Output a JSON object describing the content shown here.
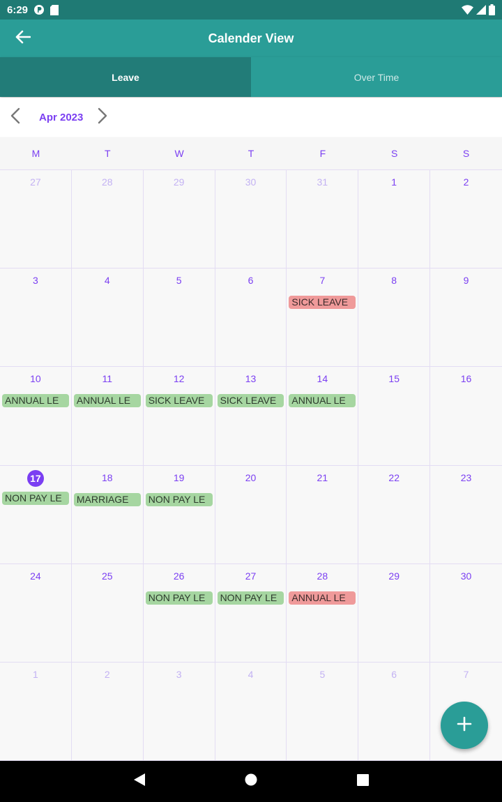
{
  "status": {
    "time": "6:29"
  },
  "app": {
    "title": "Calender View"
  },
  "tabs": [
    {
      "label": "Leave",
      "active": true
    },
    {
      "label": "Over Time",
      "active": false
    }
  ],
  "calendar": {
    "month": "Apr 2023",
    "weekdays": [
      "M",
      "T",
      "W",
      "T",
      "F",
      "S",
      "S"
    ],
    "cells": [
      {
        "day": "27",
        "muted": true,
        "events": []
      },
      {
        "day": "28",
        "muted": true,
        "events": []
      },
      {
        "day": "29",
        "muted": true,
        "events": []
      },
      {
        "day": "30",
        "muted": true,
        "events": []
      },
      {
        "day": "31",
        "muted": true,
        "events": []
      },
      {
        "day": "1",
        "events": []
      },
      {
        "day": "2",
        "events": []
      },
      {
        "day": "3",
        "events": []
      },
      {
        "day": "4",
        "events": []
      },
      {
        "day": "5",
        "events": []
      },
      {
        "day": "6",
        "events": []
      },
      {
        "day": "7",
        "events": [
          {
            "label": "SICK LEAVE",
            "color": "red"
          }
        ]
      },
      {
        "day": "8",
        "events": []
      },
      {
        "day": "9",
        "events": []
      },
      {
        "day": "10",
        "events": [
          {
            "label": "ANNUAL LE",
            "color": "green"
          }
        ]
      },
      {
        "day": "11",
        "events": [
          {
            "label": "ANNUAL LE",
            "color": "green"
          }
        ]
      },
      {
        "day": "12",
        "events": [
          {
            "label": "SICK LEAVE",
            "color": "green"
          }
        ]
      },
      {
        "day": "13",
        "events": [
          {
            "label": "SICK LEAVE",
            "color": "green"
          }
        ]
      },
      {
        "day": "14",
        "events": [
          {
            "label": "ANNUAL LE",
            "color": "green"
          }
        ]
      },
      {
        "day": "15",
        "events": []
      },
      {
        "day": "16",
        "events": []
      },
      {
        "day": "17",
        "today": true,
        "events": [
          {
            "label": "NON PAY LE",
            "color": "green"
          }
        ]
      },
      {
        "day": "18",
        "events": [
          {
            "label": "MARRIAGE",
            "color": "green"
          }
        ]
      },
      {
        "day": "19",
        "events": [
          {
            "label": "NON PAY LE",
            "color": "green"
          }
        ]
      },
      {
        "day": "20",
        "events": []
      },
      {
        "day": "21",
        "events": []
      },
      {
        "day": "22",
        "events": []
      },
      {
        "day": "23",
        "events": []
      },
      {
        "day": "24",
        "events": []
      },
      {
        "day": "25",
        "events": []
      },
      {
        "day": "26",
        "events": [
          {
            "label": "NON PAY LE",
            "color": "green"
          }
        ]
      },
      {
        "day": "27",
        "events": [
          {
            "label": "NON PAY LE",
            "color": "green"
          }
        ]
      },
      {
        "day": "28",
        "events": [
          {
            "label": "ANNUAL LE",
            "color": "red"
          }
        ]
      },
      {
        "day": "29",
        "events": []
      },
      {
        "day": "30",
        "events": []
      },
      {
        "day": "1",
        "muted": true,
        "events": []
      },
      {
        "day": "2",
        "muted": true,
        "events": []
      },
      {
        "day": "3",
        "muted": true,
        "events": []
      },
      {
        "day": "4",
        "muted": true,
        "events": []
      },
      {
        "day": "5",
        "muted": true,
        "events": []
      },
      {
        "day": "6",
        "muted": true,
        "events": []
      },
      {
        "day": "7",
        "muted": true,
        "events": []
      }
    ]
  },
  "fab": {
    "icon": "plus-icon"
  },
  "colors": {
    "primary": "#2a9d97",
    "primary_dark": "#227c78",
    "accent": "#7b3ff2",
    "event_green": "#a6d6a1",
    "event_red": "#ef9a9a"
  }
}
